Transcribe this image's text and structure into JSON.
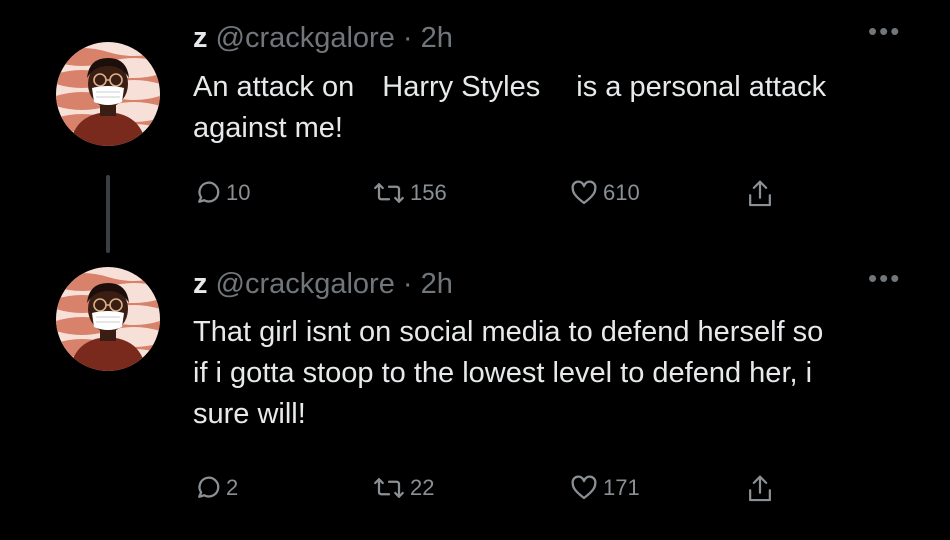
{
  "tweets": [
    {
      "display_name": "z",
      "handle": "@crackgalore",
      "separator": "·",
      "time": "2h",
      "text_before": "An attack on",
      "text_highlight": "Harry Styles",
      "text_after": "is a personal attack against me!",
      "more_icon": "more-dots-icon",
      "replies": "10",
      "retweets": "156",
      "likes": "610"
    },
    {
      "display_name": "z",
      "handle": "@crackgalore",
      "separator": "·",
      "time": "2h",
      "text": "That girl isnt on social media to defend herself so if i gotta stoop to the lowest level to defend her, i sure will!",
      "more_icon": "more-dots-icon",
      "replies": "2",
      "retweets": "22",
      "likes": "171"
    }
  ],
  "icons": [
    "reply-icon",
    "retweet-icon",
    "like-icon",
    "share-icon"
  ],
  "colors": {
    "background": "#000000",
    "text": "#e7e9ea",
    "muted": "#71767b",
    "avatar_stripe_light": "#f6e0d8",
    "avatar_stripe_dark": "#d9826b",
    "avatar_sweater": "#7a2a1c"
  }
}
